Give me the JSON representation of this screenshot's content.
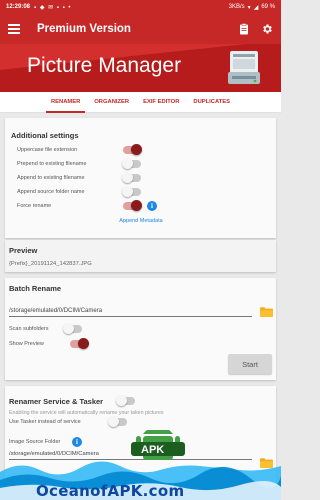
{
  "statusbar": {
    "time": "12:29:08",
    "network": "3KB/s",
    "battery": "69 %"
  },
  "toolbar": {
    "title": "Premium Version"
  },
  "banner": {
    "app_title": "Picture Manager"
  },
  "tabs": [
    {
      "label": "RENAMER",
      "active": true
    },
    {
      "label": "ORGANIZER",
      "active": false
    },
    {
      "label": "EXIF EDITOR",
      "active": false
    },
    {
      "label": "DUPLICATES",
      "active": false
    }
  ],
  "additional": {
    "title": "Additional settings",
    "options": [
      {
        "label": "Uppercase file extension",
        "on": true
      },
      {
        "label": "Prepend to existing filename",
        "on": false
      },
      {
        "label": "Append to existing filename",
        "on": false
      },
      {
        "label": "Append source folder name",
        "on": false
      },
      {
        "label": "Force rename",
        "on": true
      }
    ],
    "link": "Append Metadata"
  },
  "preview": {
    "title": "Preview",
    "value": "{Prefix}_20191124_142837.JPG"
  },
  "batch": {
    "title": "Batch Rename",
    "path": "/storage/emulated/0/DCIM/Camera",
    "scan_label": "Scan subfolders",
    "scan_on": false,
    "preview_label": "Show Preview",
    "preview_on": true,
    "start_label": "Start"
  },
  "service": {
    "title": "Renamer Service & Tasker",
    "title_on": false,
    "desc": "Enabling the service will automatically rename your taken pictures",
    "tasker_label": "Use Tasker instead of service",
    "image_folder_label": "Image Source Folder",
    "path_partial": "/storage/emulated/0/DCIM/Camera"
  },
  "watermark": {
    "text": "OceanofAPK.com",
    "badge": "APK"
  },
  "colors": {
    "primary": "#c62828",
    "accent": "#8b1a1a",
    "link": "#1e88e5"
  }
}
